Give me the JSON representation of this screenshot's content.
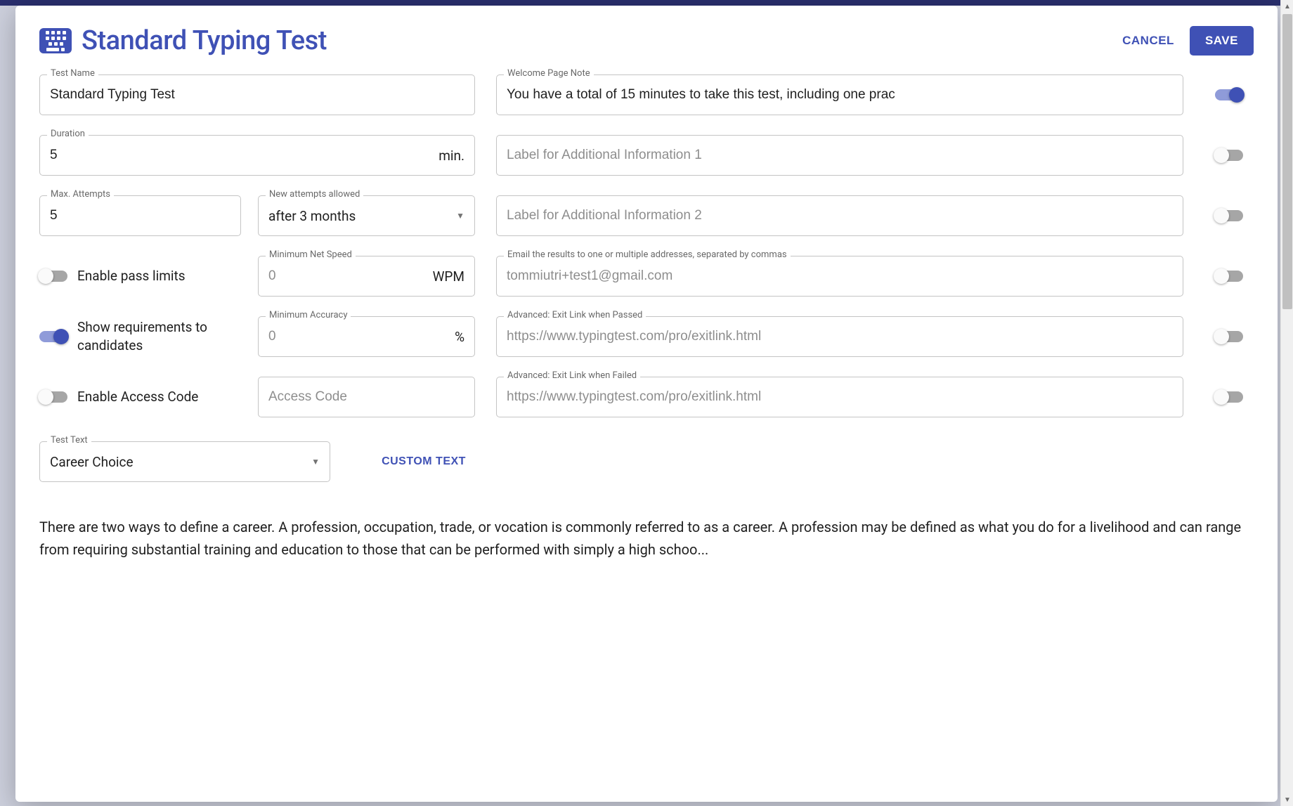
{
  "header": {
    "title": "Standard Typing Test",
    "cancel": "CANCEL",
    "save": "SAVE"
  },
  "left": {
    "testName": {
      "label": "Test Name",
      "value": "Standard Typing Test"
    },
    "duration": {
      "label": "Duration",
      "value": "5",
      "suffix": "min."
    },
    "maxAttempts": {
      "label": "Max. Attempts",
      "value": "5"
    },
    "newAttempts": {
      "label": "New attempts allowed",
      "value": "after 3 months"
    },
    "enablePass": {
      "label": "Enable pass limits",
      "on": false
    },
    "minSpeed": {
      "label": "Minimum Net Speed",
      "value": "0",
      "suffix": "WPM"
    },
    "showReq": {
      "label": "Show requirements to candidates",
      "on": true
    },
    "minAcc": {
      "label": "Minimum Accuracy",
      "value": "0",
      "suffix": "%"
    },
    "enableCode": {
      "label": "Enable Access Code",
      "on": false
    },
    "accessCode": {
      "label": "",
      "placeholder": "Access Code"
    },
    "testText": {
      "label": "Test Text",
      "value": "Career Choice"
    },
    "customText": "CUSTOM TEXT"
  },
  "right": {
    "welcome": {
      "label": "Welcome Page Note",
      "value": "You have a total of 15 minutes to take this test, including one prac",
      "on": true
    },
    "addl1": {
      "placeholder": "Label for Additional Information 1",
      "on": false
    },
    "addl2": {
      "placeholder": "Label for Additional Information 2",
      "on": false
    },
    "emailResults": {
      "label": "Email the results to one or multiple addresses, separated by commas",
      "value": "tommiutri+test1@gmail.com",
      "on": false
    },
    "exitPassed": {
      "label": "Advanced: Exit Link when Passed",
      "value": "https://www.typingtest.com/pro/exitlink.html",
      "on": false
    },
    "exitFailed": {
      "label": "Advanced: Exit Link when Failed",
      "value": "https://www.typingtest.com/pro/exitlink.html",
      "on": false
    }
  },
  "preview": "There are two ways to define a career. A profession, occupation, trade, or vocation is commonly referred to as a career. A profession may be defined as what you do for a livelihood and can range from requiring substantial training and education to those that can be performed with simply a high schoo..."
}
